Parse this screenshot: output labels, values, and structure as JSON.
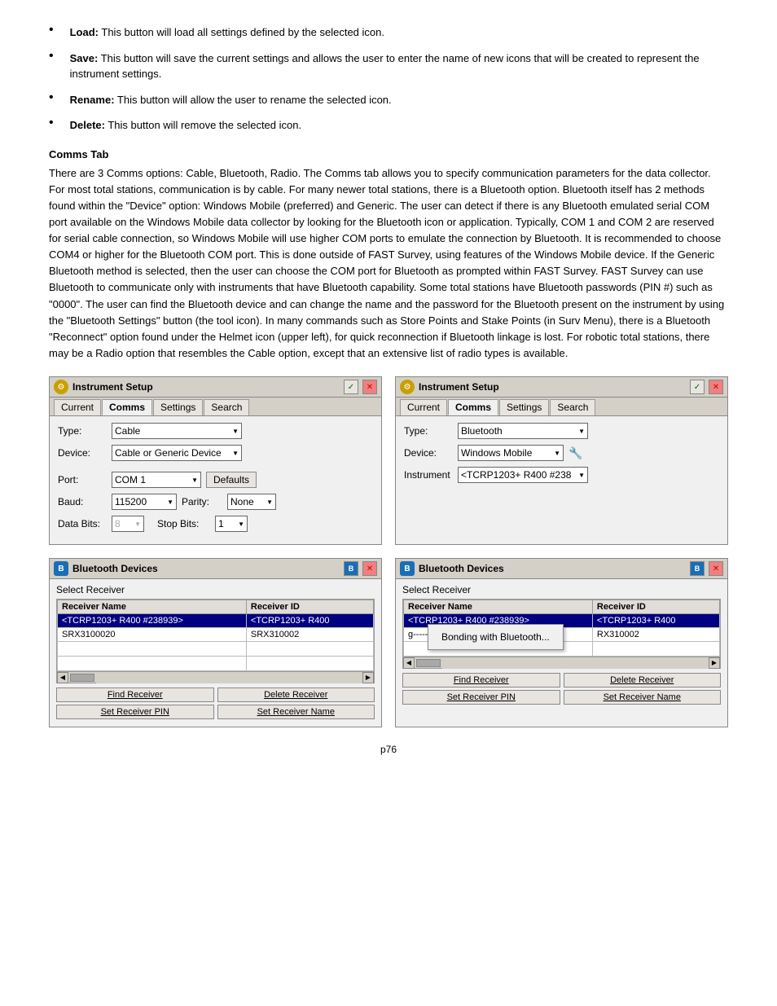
{
  "bullets": [
    {
      "label": "Load:",
      "text": "This button will load all settings defined by the selected icon."
    },
    {
      "label": "Save:",
      "text": "This button will save the current settings and allows the user to enter the name of new icons that will be created to represent the instrument settings."
    },
    {
      "label": "Rename:",
      "text": "This button will allow the user to rename the selected icon."
    },
    {
      "label": "Delete:",
      "text": "This button will remove the selected icon."
    }
  ],
  "comms_tab": {
    "header": "Comms Tab",
    "body": "There are 3 Comms options:  Cable, Bluetooth, Radio.  The Comms tab allows you to specify communication parameters for the data collector.  For most total stations, communication is by cable.   For many newer total stations, there is a Bluetooth option. Bluetooth itself has 2 methods found within the \"Device\" option:  Windows Mobile (preferred) and Generic.   The user can detect if there is any Bluetooth emulated serial COM port available on the Windows Mobile data collector by looking for the Bluetooth icon or application.  Typically, COM 1 and COM 2 are reserved for serial cable connection, so Windows Mobile will use higher COM ports to emulate the connection by Bluetooth.  It is recommended to choose COM4 or higher for the Bluetooth COM port.  This is done outside of FAST Survey, using features of the Windows Mobile device.  If the Generic Bluetooth method is selected, then the user can choose the COM port for Bluetooth as prompted within FAST Survey.  FAST Survey can use Bluetooth to communicate only with instruments that have Bluetooth capability.  Some total stations have Bluetooth passwords (PIN #) such as \"0000\".  The user can find the Bluetooth device and can change the name and the password for the Bluetooth present on the instrument by using the \"Bluetooth Settings\" button (the tool icon).  In many commands such as Store Points and Stake Points (in Surv Menu), there is a Bluetooth \"Reconnect\" option found under the Helmet icon (upper left), for quick reconnection if Bluetooth linkage is lost.  For robotic total stations, there may be a Radio option that resembles the Cable option, except that an extensive list of radio types is available."
  },
  "panel_left": {
    "title": "Instrument Setup",
    "tabs": [
      "Current",
      "Comms",
      "Settings",
      "Search"
    ],
    "active_tab": "Comms",
    "type_label": "Type:",
    "type_value": "Cable",
    "device_label": "Device:",
    "device_value": "Cable or Generic Device",
    "port_label": "Port:",
    "port_value": "COM 1",
    "baud_label": "Baud:",
    "baud_value": "115200",
    "parity_label": "Parity:",
    "parity_value": "None",
    "databits_label": "Data Bits:",
    "databits_value": "8",
    "stopbits_label": "Stop Bits:",
    "stopbits_value": "1",
    "defaults_btn": "Defaults"
  },
  "panel_right": {
    "title": "Instrument Setup",
    "tabs": [
      "Current",
      "Comms",
      "Settings",
      "Search"
    ],
    "active_tab": "Comms",
    "type_label": "Type:",
    "type_value": "Bluetooth",
    "device_label": "Device:",
    "device_value": "Windows Mobile",
    "instrument_label": "Instrument",
    "instrument_value": "<TCRP1203+ R400 #238"
  },
  "bt_panel_left": {
    "title": "Bluetooth Devices",
    "select_receiver": "Select Receiver",
    "col1": "Receiver Name",
    "col2": "Receiver ID",
    "rows": [
      {
        "name": "<TCRP1203+ R400 #238939>",
        "id": "<TCRP1203+ R400"
      },
      {
        "name": "SRX3100020",
        "id": "SRX310002"
      }
    ],
    "buttons": [
      "Find Receiver",
      "Delete Receiver",
      "Set Receiver PIN",
      "Set Receiver Name"
    ]
  },
  "bt_panel_right": {
    "title": "Bluetooth Devices",
    "select_receiver": "Select Receiver",
    "col1": "Receiver Name",
    "col2": "Receiver ID",
    "rows": [
      {
        "name": "<TCRP1203+ R400 #238939>",
        "id": "<TCRP1203+ R400"
      },
      {
        "name": "g--------",
        "id": "RX310002"
      }
    ],
    "bonding_text": "Bonding with Bluetooth...",
    "buttons": [
      "Find Receiver",
      "Delete Receiver",
      "Set Receiver PIN",
      "Set Receiver Name"
    ]
  },
  "page_number": "p76"
}
